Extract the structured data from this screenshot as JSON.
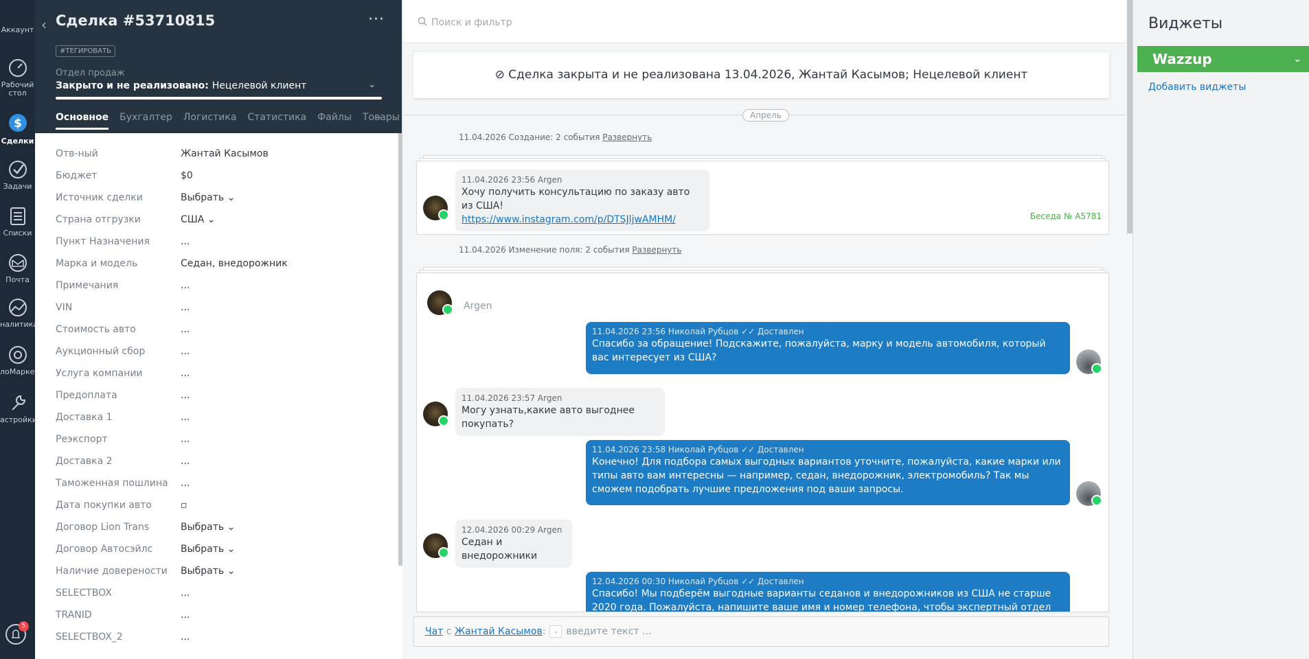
{
  "nav": {
    "account": "Аккаунт",
    "dashboard_line1": "Рабочий",
    "dashboard_line2": "стол",
    "deals": "Сделки",
    "tasks": "Задачи",
    "lists": "Списки",
    "mail": "Почта",
    "analytics": "налитика",
    "market": "лоМаркет",
    "settings": "астройки",
    "notifications_count": "5"
  },
  "deal": {
    "title": "Сделка #53710815",
    "tag_button": "#ТЕГИРОВАТЬ",
    "pipeline": "Отдел продаж",
    "status_prefix": "Закрыто и не реализовано:",
    "status_reason": "Нецелевой клиент",
    "more": "···"
  },
  "tabs": [
    "Основное",
    "Бухгалтер",
    "Логистика",
    "Статистика",
    "Файлы",
    "Товары"
  ],
  "tabs_more": "···",
  "fields": [
    {
      "label": "Отв-ный",
      "value": "Жантай Касымов"
    },
    {
      "label": "Бюджет",
      "value": "$0"
    },
    {
      "label": "Источник сделки",
      "value": "Выбрать ⌄"
    },
    {
      "label": "Страна отгрузки",
      "value": "США ⌄"
    },
    {
      "label": "Пункт Назначения",
      "value": "..."
    },
    {
      "label": "Марка и модель",
      "value": "Седан, внедорожник"
    },
    {
      "label": "Примечания",
      "value": "..."
    },
    {
      "label": "VIN",
      "value": "..."
    },
    {
      "label": "Стоимость авто",
      "value": "..."
    },
    {
      "label": "Аукционный сбор",
      "value": "..."
    },
    {
      "label": "Услуга компании",
      "value": "..."
    },
    {
      "label": "Предоплата",
      "value": "..."
    },
    {
      "label": "Доставка 1",
      "value": "..."
    },
    {
      "label": "Реэкспорт",
      "value": "..."
    },
    {
      "label": "Доставка 2",
      "value": "..."
    },
    {
      "label": "Таможенная пошлина",
      "value": "..."
    },
    {
      "label": "Дата покупки авто",
      "value": "▫"
    },
    {
      "label": "Договор Lion Trans",
      "value": "Выбрать ⌄"
    },
    {
      "label": "Договор Автосэйлс",
      "value": "Выбрать ⌄"
    },
    {
      "label": "Наличие доверености",
      "value": "Выбрать ⌄"
    },
    {
      "label": "SELECTBOX",
      "value": "..."
    },
    {
      "label": "TRANID",
      "value": "..."
    },
    {
      "label": "SELECTBOX_2",
      "value": "..."
    }
  ],
  "feed": {
    "search_placeholder": "Поиск и фильтр",
    "closed_banner": "⊘ Сделка закрыта и не реализована 13.04.2026, Жантай Касымов; Нецелевой клиент",
    "month": "Апрель",
    "event1_text": "11.04.2026 Создание: 2 события",
    "event_expand": "Развернуть",
    "event2_text": "11.04.2026 Изменение поля: 2 события",
    "msg1_meta": "11.04.2026 23:56 Argen",
    "msg1_text": "Хочу получить консультацию по заказу авто из США!",
    "msg1_link": "https://www.instagram.com/p/DTSJljwAMHM/",
    "conv_no": "Беседа № A5781",
    "argen": "Argen",
    "out1_meta": "11.04.2026 23:56 Николай Рубцов ✓✓ Доставлен",
    "out1_text": "Спасибо за обращение! Подскажите, пожалуйста, марку и модель автомобиля, который вас интересует из США?",
    "in2_meta": "11.04.2026 23:57 Argen",
    "in2_text": "Могу узнать,какие авто выгоднее покупать?",
    "out2_meta": "11.04.2026 23:58 Николай Рубцов ✓✓ Доставлен",
    "out2_text": "Конечно! Для подбора самых выгодных вариантов уточните, пожалуйста, какие марки или типы авто вам интересны — например, седан, внедорожник, электромобиль? Так мы сможем подобрать лучшие предложения под ваши запросы.",
    "in3_meta": "12.04.2026 00:29 Argen",
    "in3_text": "Седан и внедорожники",
    "out3_meta": "12.04.2026 00:30 Николай Рубцов ✓✓ Доставлен",
    "out3_text": "Спасибо! Мы подберём выгодные варианты седанов и внедорожников из США не старше 2020 года. Пожалуйста, напишите ваше имя и номер телефона, чтобы экспертный отдел мог связаться с вами и",
    "chat_label": "Чат",
    "chat_with": "с",
    "chat_contact": "Жантай Касымов",
    "chat_placeholder": "введите текст ..."
  },
  "widgets": {
    "title": "Виджеты",
    "wazzup": "Wazzup",
    "add": "Добавить виджеты"
  },
  "colors": {
    "nav_bg": "#1f2a38",
    "header_bg": "#263340",
    "accent_blue": "#1d7cc4",
    "wazzup_green": "#4caf50"
  }
}
